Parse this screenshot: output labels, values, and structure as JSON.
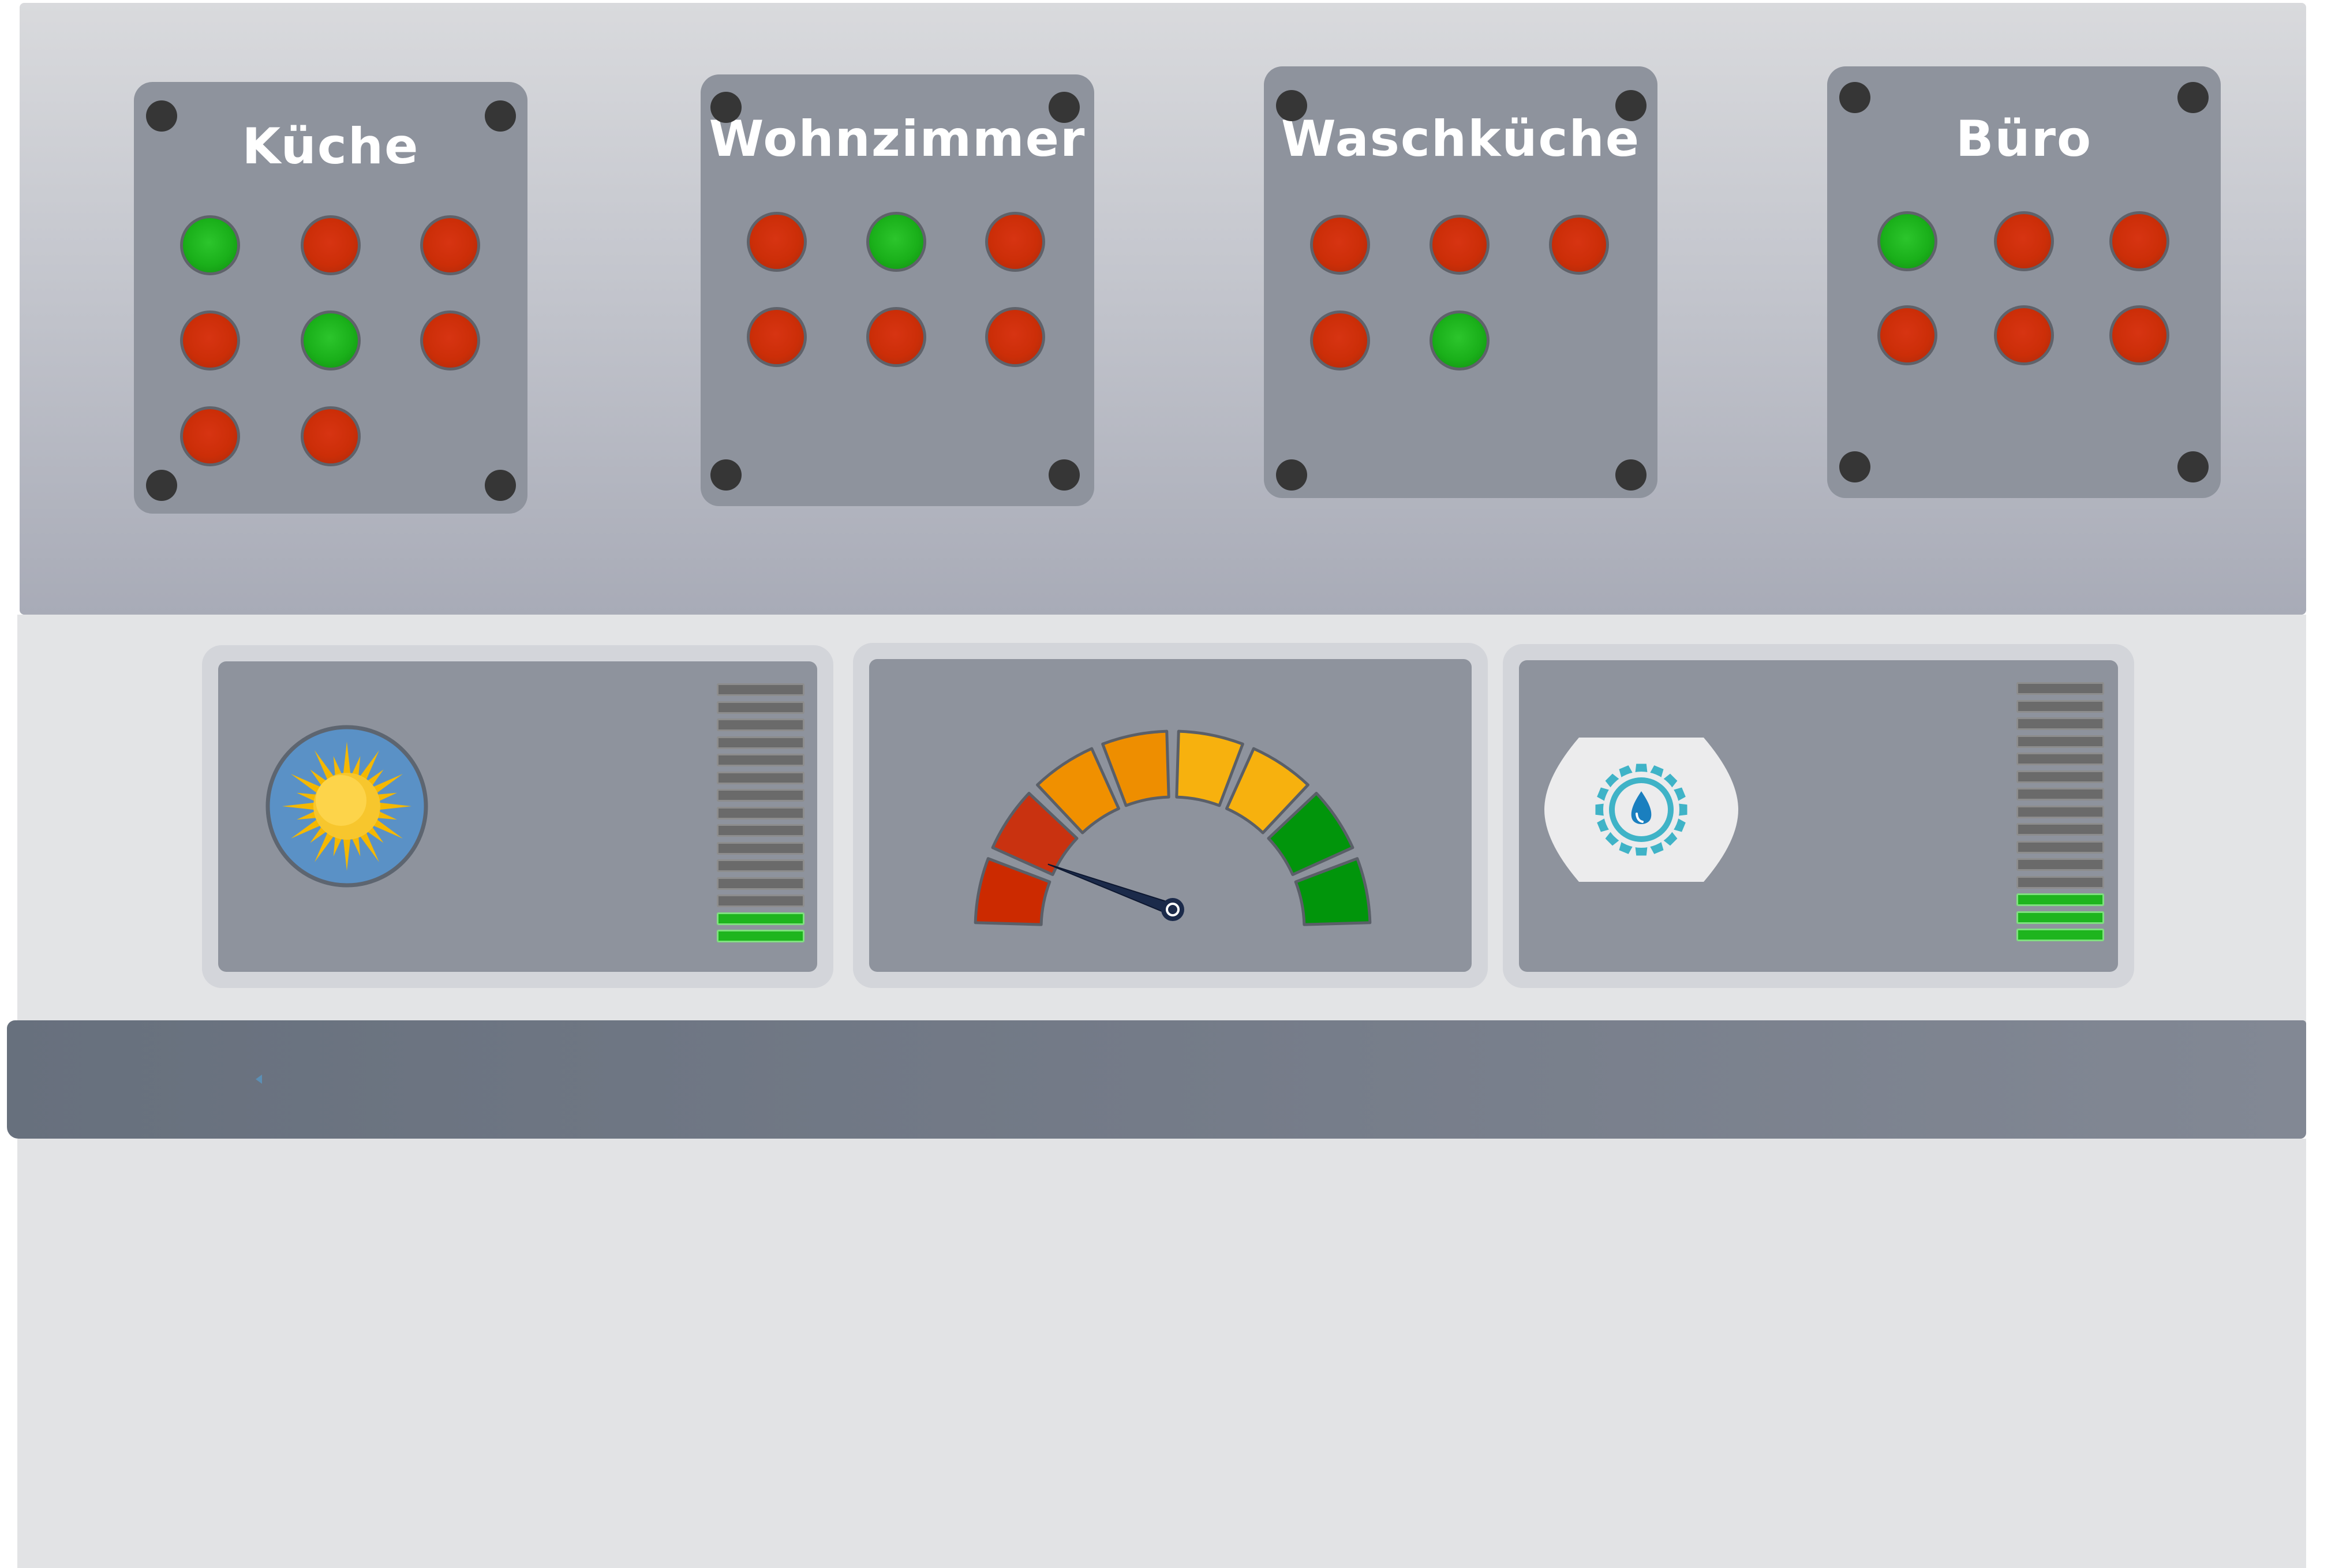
{
  "rooms": [
    {
      "name": "Küche",
      "lamps": [
        "on",
        "off",
        "off",
        "off",
        "on",
        "off",
        "off",
        "off"
      ]
    },
    {
      "name": "Wohnzimmer",
      "lamps": [
        "off",
        "on",
        "off",
        "off",
        "off",
        "off"
      ]
    },
    {
      "name": "Waschküche",
      "lamps": [
        "off",
        "off",
        "off",
        "off",
        "on"
      ]
    },
    {
      "name": "Büro",
      "lamps": [
        "on",
        "off",
        "off",
        "off",
        "off",
        "off"
      ]
    }
  ],
  "modules": {
    "sun": {
      "icon": "sun-icon",
      "level_segments": 15,
      "level_lit": 2
    },
    "gauge": {
      "segments": 10,
      "needle_fraction": 0.2,
      "segment_colors": [
        "#cc2a00",
        "#c93210",
        "#f09000",
        "#ee8e00",
        "#f7b10e",
        "#f7b10e",
        "#01950b",
        "#01950b"
      ]
    },
    "water": {
      "icon": "water-drop-gear-icon",
      "level_segments": 15,
      "level_lit": 3
    }
  },
  "status_strip": {
    "icon": "play-left-icon"
  },
  "colors": {
    "lamp_on": "#1ab01a",
    "lamp_off": "#cc2e08",
    "panel": "#8e939d",
    "screw": "#363636"
  }
}
